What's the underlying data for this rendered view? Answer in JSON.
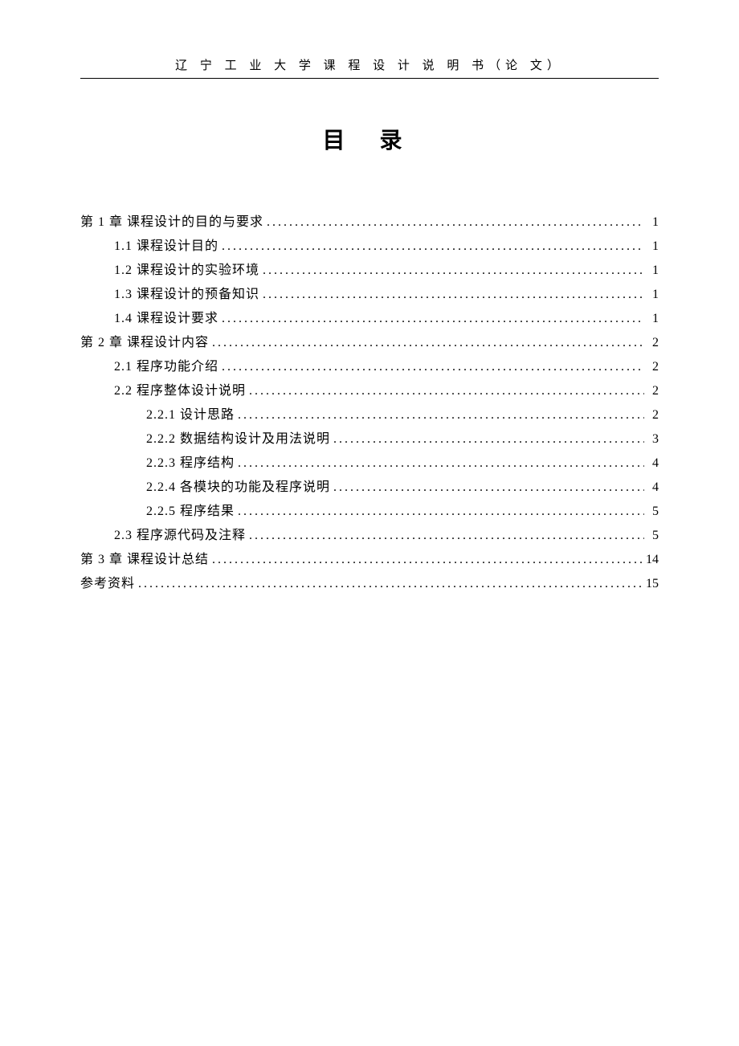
{
  "header": "辽 宁 工 业 大 学 课 程 设 计 说 明 书（论 文）",
  "title": "目  录",
  "toc": [
    {
      "label": "第 1 章   课程设计的目的与要求",
      "page": "1",
      "level": 0
    },
    {
      "label": "1.1 课程设计目的",
      "page": "1",
      "level": 1
    },
    {
      "label": "1.2 课程设计的实验环境",
      "page": "1",
      "level": 1
    },
    {
      "label": "1.3 课程设计的预备知识",
      "page": "1",
      "level": 1
    },
    {
      "label": "1.4 课程设计要求",
      "page": "1",
      "level": 1
    },
    {
      "label": "第 2 章   课程设计内容",
      "page": "2",
      "level": 0
    },
    {
      "label": "2.1 程序功能介绍",
      "page": "2",
      "level": 1
    },
    {
      "label": "2.2 程序整体设计说明",
      "page": "2",
      "level": 1
    },
    {
      "label": "2.2.1 设计思路",
      "page": "2",
      "level": 2
    },
    {
      "label": "2.2.2 数据结构设计及用法说明",
      "page": "3",
      "level": 2
    },
    {
      "label": "2.2.3 程序结构",
      "page": "4",
      "level": 2
    },
    {
      "label": "2.2.4 各模块的功能及程序说明",
      "page": "4",
      "level": 2
    },
    {
      "label": "2.2.5 程序结果",
      "page": "5",
      "level": 2
    },
    {
      "label": "2.3 程序源代码及注释",
      "page": "5",
      "level": 1
    },
    {
      "label": "第 3 章 课程设计总结",
      "page": "14",
      "level": 0
    },
    {
      "label": "参考资料",
      "page": "15",
      "level": 0
    }
  ]
}
